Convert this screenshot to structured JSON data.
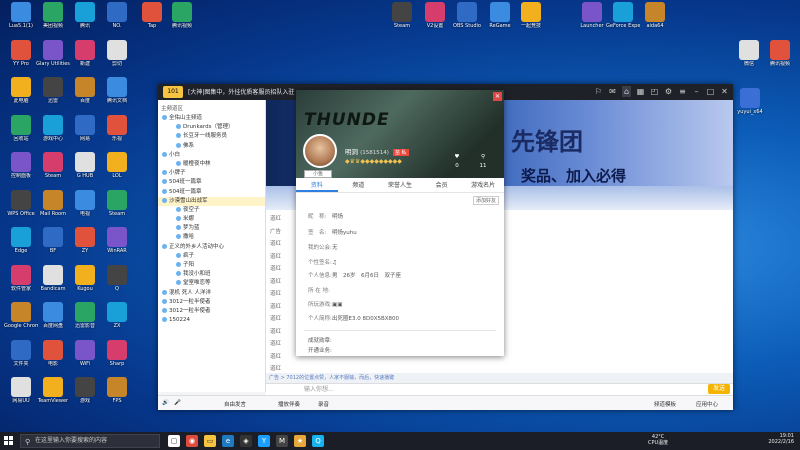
{
  "desktop": {
    "icons_col1": [
      "Lua5.1(1)",
      "YY Pro",
      "此电脑",
      "回收站",
      "控制面板",
      "WPS Office",
      "Edge",
      "软件管家",
      "Google Chrome",
      "文件夹",
      "网易UU"
    ],
    "icons_col2": [
      "美团视频",
      "Glary Utilities",
      "迅雷",
      "游戏中心",
      "Steam",
      "Mail Room",
      "BF",
      "Bandicam",
      "百度网盘",
      "电影",
      "TeamViewer"
    ],
    "icons_col3": [
      "腾讯",
      "新建",
      "百度",
      "网易",
      "G HUB",
      "电视",
      "ZY",
      "Kugou",
      "迅雷影音",
      "WiFi",
      "游戏"
    ],
    "icons_col4": [
      "NO.",
      "剪切",
      "腾讯文档",
      "乐视",
      "LOL",
      "Steam",
      "WinRAR",
      "Q",
      "ZX",
      "Sharp",
      "FPS"
    ],
    "icons_top": [
      "Tap",
      "腾讯视频",
      "Steam",
      "V2设置",
      "OBS Studio",
      "ReGame",
      "一起竞技",
      "Launcher",
      "GeForce Experience",
      "aida64",
      "微信",
      "腾讯视频"
    ],
    "icon_right_small": "yuyui_x64"
  },
  "yy": {
    "marquee": "[大神|图集中，外挂优质客服员招队入驻",
    "title_logo": "101",
    "panel_header": "主频道区",
    "channels": [
      "全佑山主频道",
      "Drunkards（管理）",
      "长豆牙一线服务员",
      "佛系",
      "小白",
      "暖橙夜中林",
      "小牌子",
      "504班一篇章",
      "504班一篇章",
      "沙漠雪山出战军",
      "夜空子",
      "米娜",
      "梦为蓝",
      "撒哈",
      "正义的外乡人活动中心",
      "疯子",
      "子阳",
      "我没小和班",
      "堂室唯恋等",
      "混机 死人 人洋洋",
      "3012一粒半使者",
      "3012一粒半使者",
      "150224"
    ],
    "banner_title": "先锋团",
    "banner_sub": "奖品、加入必得",
    "chat_lines": [
      "道红",
      "广告",
      "道红",
      "道红",
      "道红",
      "道红",
      "道红",
      "道红",
      "道红",
      "道红",
      "道红",
      "道红",
      "道红"
    ],
    "chat_input_hint": "广告 > 7012的位置点赞，人家不服输，而后，快速播键",
    "chat_input_placeholder": "输入你想...",
    "bottom_bar": [
      "自由发言",
      "播放伴奏",
      "录音",
      "频道模板",
      "应用中心"
    ],
    "send_label": "发送"
  },
  "profile": {
    "banner_logo": "THUNDE",
    "name": "明洞",
    "uid": "(1581514)",
    "vtag": "苗 私",
    "medals": "◆♛♛◆◆◆◆◆◆◆◆◆",
    "stat_labels": [
      "♥",
      "⚲"
    ],
    "stat_values": [
      "0",
      "11"
    ],
    "tag_label": "小鱼",
    "tabs": [
      "资料",
      "频道",
      "荣誉人生",
      "会员",
      "游戏名片"
    ],
    "add_friend": "添加好友",
    "fields": [
      {
        "k": "昵　称:",
        "v": "明炀"
      },
      {
        "k": "签　名:",
        "v": "明炀yuhu"
      },
      {
        "k": "我的公会:",
        "v": "无"
      },
      {
        "k": "个性签名:",
        "v": "♫"
      },
      {
        "k": "个人信息:",
        "v": "男　26岁　6月6日　双子座"
      },
      {
        "k": "所 在 地:",
        "v": ""
      },
      {
        "k": "所玩游戏:",
        "v": "▣▣"
      },
      {
        "k": "个人简称:",
        "v": "出死圈E3.0 8D0X5BX800"
      }
    ],
    "foot": [
      "成就勋章:",
      "开通业务:"
    ]
  },
  "taskbar": {
    "search_placeholder": "在这里输入你要搜索的内容",
    "weather_temp": "42°C",
    "weather_label": "CPU温度",
    "time": "19:01",
    "date": "2022/2/16"
  },
  "colors": {
    "accent": "#2f7fe0",
    "send": "#f5b400",
    "close": "#e04848"
  }
}
